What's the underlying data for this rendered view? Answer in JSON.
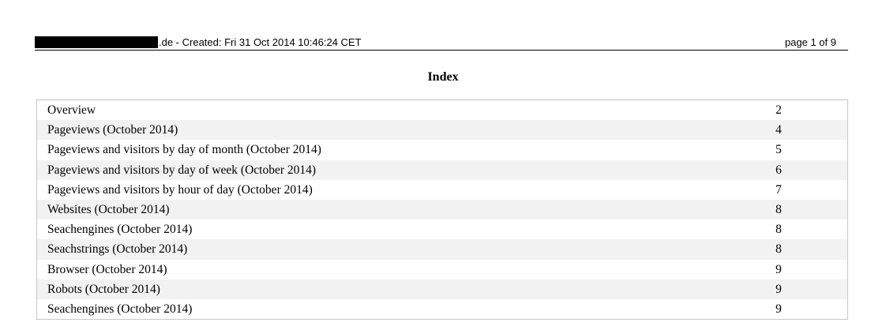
{
  "header": {
    "created_text": ".de - Created: Fri 31 Oct 2014 10:46:24 CET",
    "page_text": "page 1 of 9"
  },
  "index": {
    "title": "Index",
    "entries": [
      {
        "title": "Overview",
        "page": "2"
      },
      {
        "title": "Pageviews (October 2014)",
        "page": "4"
      },
      {
        "title": "Pageviews and visitors by day of month (October 2014)",
        "page": "5"
      },
      {
        "title": "Pageviews and visitors by day of week (October 2014)",
        "page": "6"
      },
      {
        "title": "Pageviews and visitors by hour of day (October 2014)",
        "page": "7"
      },
      {
        "title": "Websites (October 2014)",
        "page": "8"
      },
      {
        "title": "Seachengines (October 2014)",
        "page": "8"
      },
      {
        "title": "Seachstrings (October 2014)",
        "page": "8"
      },
      {
        "title": "Browser (October 2014)",
        "page": "9"
      },
      {
        "title": "Robots (October 2014)",
        "page": "9"
      },
      {
        "title": "Seachengines (October 2014)",
        "page": "9"
      }
    ]
  }
}
